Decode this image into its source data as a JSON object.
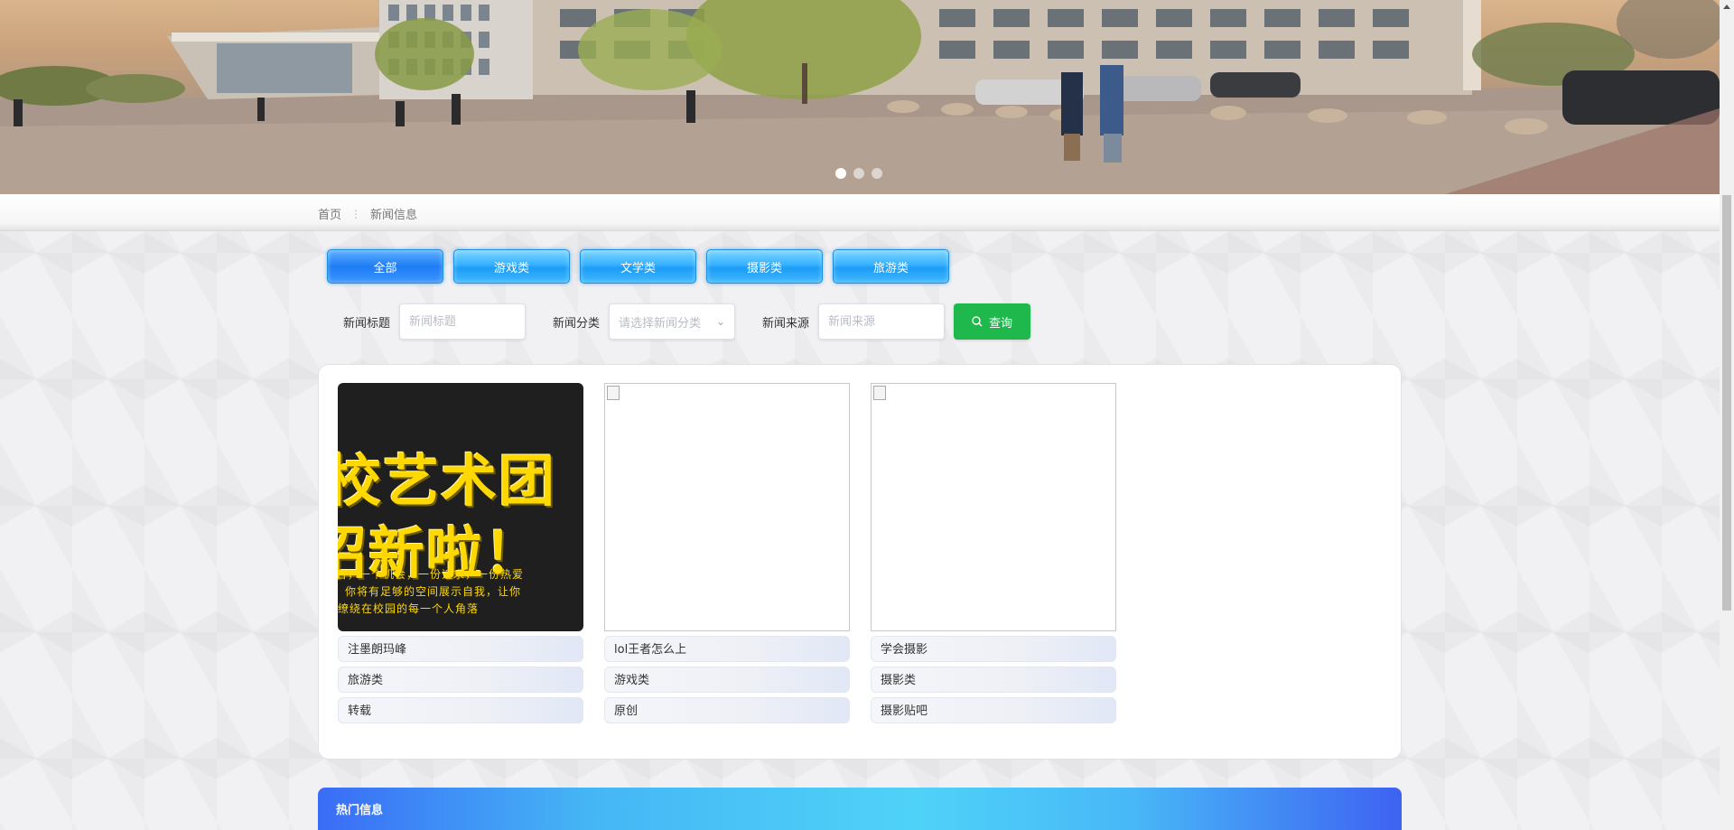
{
  "carousel": {
    "slide_count": 3,
    "active_index": 0
  },
  "breadcrumb": {
    "home": "首页",
    "separator": "⋮",
    "current": "新闻信息"
  },
  "tabs": [
    {
      "label": "全部",
      "active": true
    },
    {
      "label": "游戏类",
      "active": false
    },
    {
      "label": "文学类",
      "active": false
    },
    {
      "label": "摄影类",
      "active": false
    },
    {
      "label": "旅游类",
      "active": false
    }
  ],
  "search": {
    "title_label": "新闻标题",
    "title_placeholder": "新闻标题",
    "category_label": "新闻分类",
    "category_placeholder": "请选择新闻分类",
    "source_label": "新闻来源",
    "source_placeholder": "新闻来源",
    "query_label": "查询"
  },
  "news": [
    {
      "title": "注墨朗玛峰",
      "category": "旅游类",
      "source": "转载",
      "poster": {
        "line1": "校艺术团",
        "line2": "招新啦！",
        "line3": "台，一个机会，一份追求，一份热爱",
        "line4": "你将有足够的空间展示自我，让你",
        "line5": "缭绕在校园的每一个人角落"
      }
    },
    {
      "title": "lol王者怎么上",
      "category": "游戏类",
      "source": "原创"
    },
    {
      "title": "学会摄影",
      "category": "摄影类",
      "source": "摄影贴吧"
    }
  ],
  "hot": {
    "title": "热门信息"
  },
  "colors": {
    "tab_blue": "#1c9cf5",
    "query_green": "#1fb84c",
    "hot_gradient_start": "#3a6cf6",
    "hot_gradient_mid": "#4fd2f8"
  }
}
